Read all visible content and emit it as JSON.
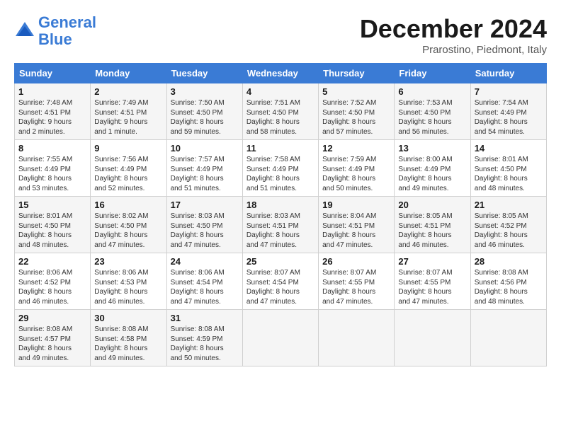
{
  "header": {
    "logo_line1": "General",
    "logo_line2": "Blue",
    "month_title": "December 2024",
    "subtitle": "Prarostino, Piedmont, Italy"
  },
  "calendar": {
    "day_headers": [
      "Sunday",
      "Monday",
      "Tuesday",
      "Wednesday",
      "Thursday",
      "Friday",
      "Saturday"
    ],
    "weeks": [
      [
        {
          "day": "1",
          "info": "Sunrise: 7:48 AM\nSunset: 4:51 PM\nDaylight: 9 hours\nand 2 minutes."
        },
        {
          "day": "2",
          "info": "Sunrise: 7:49 AM\nSunset: 4:51 PM\nDaylight: 9 hours\nand 1 minute."
        },
        {
          "day": "3",
          "info": "Sunrise: 7:50 AM\nSunset: 4:50 PM\nDaylight: 8 hours\nand 59 minutes."
        },
        {
          "day": "4",
          "info": "Sunrise: 7:51 AM\nSunset: 4:50 PM\nDaylight: 8 hours\nand 58 minutes."
        },
        {
          "day": "5",
          "info": "Sunrise: 7:52 AM\nSunset: 4:50 PM\nDaylight: 8 hours\nand 57 minutes."
        },
        {
          "day": "6",
          "info": "Sunrise: 7:53 AM\nSunset: 4:50 PM\nDaylight: 8 hours\nand 56 minutes."
        },
        {
          "day": "7",
          "info": "Sunrise: 7:54 AM\nSunset: 4:49 PM\nDaylight: 8 hours\nand 54 minutes."
        }
      ],
      [
        {
          "day": "8",
          "info": "Sunrise: 7:55 AM\nSunset: 4:49 PM\nDaylight: 8 hours\nand 53 minutes."
        },
        {
          "day": "9",
          "info": "Sunrise: 7:56 AM\nSunset: 4:49 PM\nDaylight: 8 hours\nand 52 minutes."
        },
        {
          "day": "10",
          "info": "Sunrise: 7:57 AM\nSunset: 4:49 PM\nDaylight: 8 hours\nand 51 minutes."
        },
        {
          "day": "11",
          "info": "Sunrise: 7:58 AM\nSunset: 4:49 PM\nDaylight: 8 hours\nand 51 minutes."
        },
        {
          "day": "12",
          "info": "Sunrise: 7:59 AM\nSunset: 4:49 PM\nDaylight: 8 hours\nand 50 minutes."
        },
        {
          "day": "13",
          "info": "Sunrise: 8:00 AM\nSunset: 4:49 PM\nDaylight: 8 hours\nand 49 minutes."
        },
        {
          "day": "14",
          "info": "Sunrise: 8:01 AM\nSunset: 4:50 PM\nDaylight: 8 hours\nand 48 minutes."
        }
      ],
      [
        {
          "day": "15",
          "info": "Sunrise: 8:01 AM\nSunset: 4:50 PM\nDaylight: 8 hours\nand 48 minutes."
        },
        {
          "day": "16",
          "info": "Sunrise: 8:02 AM\nSunset: 4:50 PM\nDaylight: 8 hours\nand 47 minutes."
        },
        {
          "day": "17",
          "info": "Sunrise: 8:03 AM\nSunset: 4:50 PM\nDaylight: 8 hours\nand 47 minutes."
        },
        {
          "day": "18",
          "info": "Sunrise: 8:03 AM\nSunset: 4:51 PM\nDaylight: 8 hours\nand 47 minutes."
        },
        {
          "day": "19",
          "info": "Sunrise: 8:04 AM\nSunset: 4:51 PM\nDaylight: 8 hours\nand 47 minutes."
        },
        {
          "day": "20",
          "info": "Sunrise: 8:05 AM\nSunset: 4:51 PM\nDaylight: 8 hours\nand 46 minutes."
        },
        {
          "day": "21",
          "info": "Sunrise: 8:05 AM\nSunset: 4:52 PM\nDaylight: 8 hours\nand 46 minutes."
        }
      ],
      [
        {
          "day": "22",
          "info": "Sunrise: 8:06 AM\nSunset: 4:52 PM\nDaylight: 8 hours\nand 46 minutes."
        },
        {
          "day": "23",
          "info": "Sunrise: 8:06 AM\nSunset: 4:53 PM\nDaylight: 8 hours\nand 46 minutes."
        },
        {
          "day": "24",
          "info": "Sunrise: 8:06 AM\nSunset: 4:54 PM\nDaylight: 8 hours\nand 47 minutes."
        },
        {
          "day": "25",
          "info": "Sunrise: 8:07 AM\nSunset: 4:54 PM\nDaylight: 8 hours\nand 47 minutes."
        },
        {
          "day": "26",
          "info": "Sunrise: 8:07 AM\nSunset: 4:55 PM\nDaylight: 8 hours\nand 47 minutes."
        },
        {
          "day": "27",
          "info": "Sunrise: 8:07 AM\nSunset: 4:55 PM\nDaylight: 8 hours\nand 47 minutes."
        },
        {
          "day": "28",
          "info": "Sunrise: 8:08 AM\nSunset: 4:56 PM\nDaylight: 8 hours\nand 48 minutes."
        }
      ],
      [
        {
          "day": "29",
          "info": "Sunrise: 8:08 AM\nSunset: 4:57 PM\nDaylight: 8 hours\nand 49 minutes."
        },
        {
          "day": "30",
          "info": "Sunrise: 8:08 AM\nSunset: 4:58 PM\nDaylight: 8 hours\nand 49 minutes."
        },
        {
          "day": "31",
          "info": "Sunrise: 8:08 AM\nSunset: 4:59 PM\nDaylight: 8 hours\nand 50 minutes."
        },
        {
          "day": "",
          "info": ""
        },
        {
          "day": "",
          "info": ""
        },
        {
          "day": "",
          "info": ""
        },
        {
          "day": "",
          "info": ""
        }
      ]
    ]
  }
}
